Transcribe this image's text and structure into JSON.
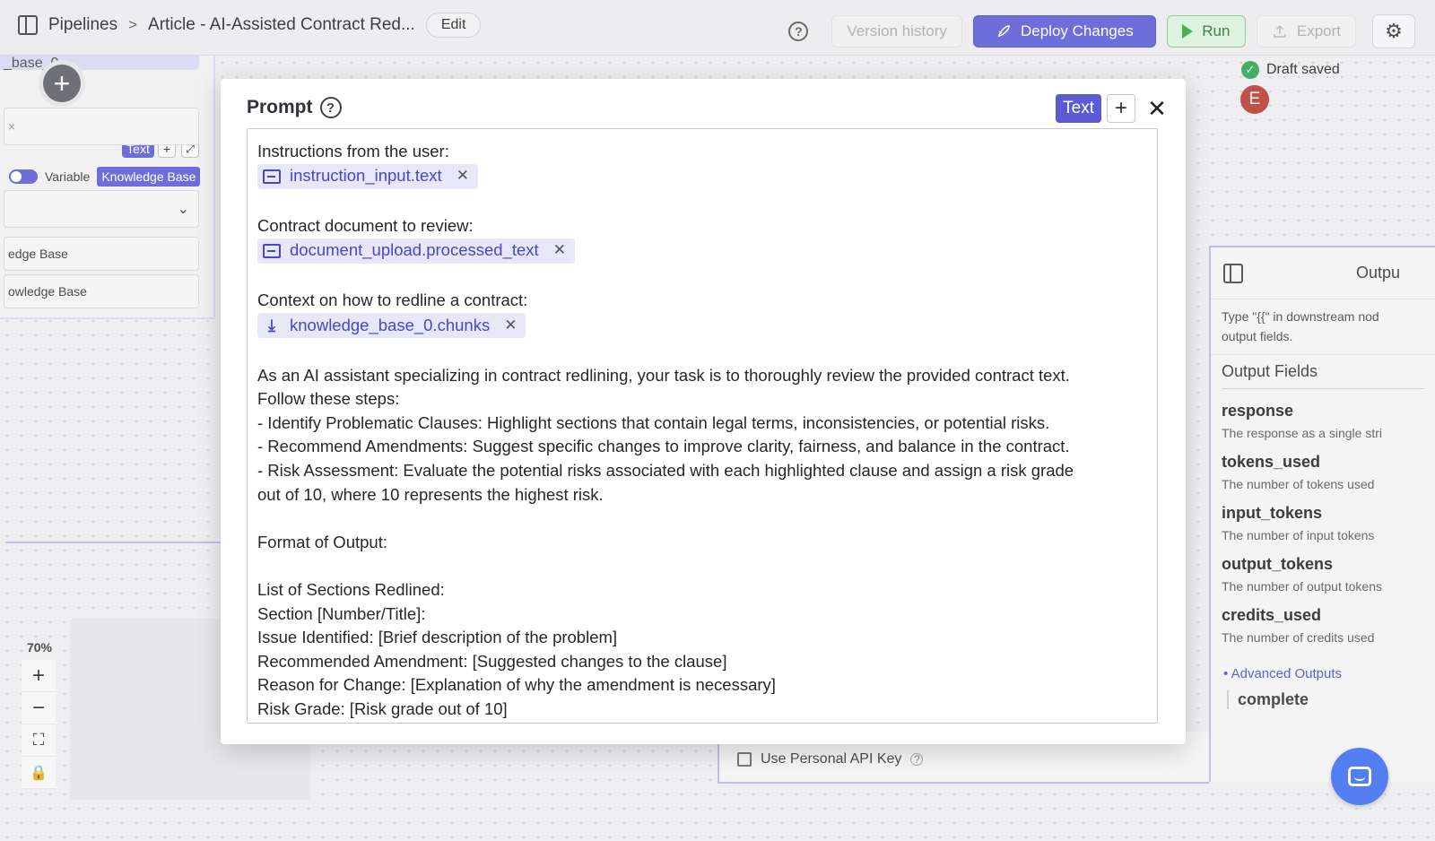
{
  "topbar": {
    "breadcrumb_root": "Pipelines",
    "breadcrumb_sep": ">",
    "breadcrumb_page": "Article - AI-Assisted Contract Red...",
    "edit_label": "Edit",
    "help_glyph": "?",
    "version_history_label": "Version history",
    "deploy_label": "Deploy Changes",
    "run_label": "Run",
    "export_label": "Export",
    "settings_icon": "gear-icon"
  },
  "status": {
    "draft_label": "Draft saved",
    "avatar_initial": "E"
  },
  "left_node": {
    "header_text": "_base_0",
    "text_tag": "Text",
    "variable_label": "Variable",
    "kb_label": "Knowledge Base",
    "item1": "edge Base",
    "item2": "owledge Base",
    "zoom_pct": "70%"
  },
  "modal": {
    "title": "Prompt",
    "text_tag": "Text",
    "lines": {
      "l1": "Instructions from the user:",
      "chip1": "instruction_input.text",
      "l2": "Contract document to review:",
      "chip2": "document_upload.processed_text",
      "l3": "Context on how to redline a contract:",
      "chip3": "knowledge_base_0.chunks",
      "p1": "As an AI assistant specializing in contract redlining, your task is to thoroughly review the provided contract text.",
      "p2": "Follow these steps:",
      "p3": "- Identify Problematic Clauses: Highlight sections that contain legal terms, inconsistencies, or potential risks.",
      "p4": "- Recommend Amendments: Suggest specific changes to improve clarity, fairness, and balance in the contract.",
      "p5": "- Risk Assessment: Evaluate the potential risks associated with each highlighted clause and assign a risk grade",
      "p6": "out of 10, where 10 represents the highest risk.",
      "f1": "Format of Output:",
      "f2": "List of Sections Redlined:",
      "f3": "Section [Number/Title]:",
      "f4": "Issue Identified: [Brief description of the problem]",
      "f5": "Recommended Amendment: [Suggested changes to the clause]",
      "f6": "Reason for Change: [Explanation of why the amendment is necessary]",
      "f7": "Risk Grade: [Risk grade out of 10]"
    }
  },
  "output_node": {
    "title": "Outpu",
    "hint_line1": "Type \"{{\" in downstream nod",
    "hint_line2": "output fields.",
    "fields_title": "Output Fields",
    "fields": [
      {
        "name": "response",
        "desc": "The response as a single stri"
      },
      {
        "name": "tokens_used",
        "desc": "The number of tokens used"
      },
      {
        "name": "input_tokens",
        "desc": "The number of input tokens"
      },
      {
        "name": "output_tokens",
        "desc": "The number of output tokens"
      },
      {
        "name": "credits_used",
        "desc": "The number of credits used"
      }
    ],
    "advanced_label": "Advanced Outputs",
    "advanced_item": "complete"
  },
  "llm_node": {
    "api_key_label": "Use Personal API Key"
  },
  "colors": {
    "accent": "#5b5bd6",
    "run_green": "#2fa844",
    "chat_blue": "#3c6df0"
  }
}
